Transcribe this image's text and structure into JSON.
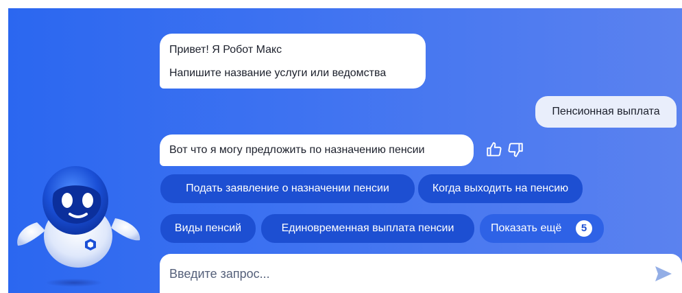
{
  "chat": {
    "bot_greeting": {
      "line1": "Привет! Я Робот Макс",
      "line2": "Напишите название услуги или ведомства"
    },
    "user_message": "Пенсионная выплата",
    "bot_offer": "Вот что я могу предложить по назначению пенсии"
  },
  "feedback": {
    "like_icon": "thumbs-up-icon",
    "dislike_icon": "thumbs-down-icon"
  },
  "suggestions": [
    {
      "label": "Подать заявление о назначении пенсии"
    },
    {
      "label": "Когда выходить на пенсию"
    },
    {
      "label": "Виды пенсий"
    },
    {
      "label": "Единовременная выплата пенсии"
    },
    {
      "label": "Показать ещё",
      "count": "5"
    }
  ],
  "input": {
    "placeholder": "Введите запрос...",
    "value": ""
  },
  "send_icon": "send-icon",
  "colors": {
    "background_start": "#2b67f0",
    "background_end": "#5b82ef",
    "chip_dark": "#1d4fd2",
    "chip_light": "#2e62e6",
    "bubble": "#ffffff",
    "user_bubble": "#e9eefb"
  }
}
